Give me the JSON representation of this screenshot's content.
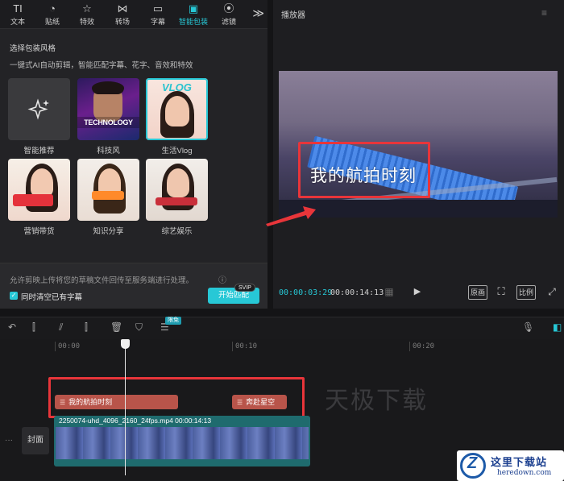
{
  "tabs": [
    {
      "label": "文本",
      "icon": "text-icon",
      "glyph": "TI"
    },
    {
      "label": "贴纸",
      "icon": "sticker-icon",
      "glyph": "◔"
    },
    {
      "label": "特效",
      "icon": "effects-icon",
      "glyph": "☆"
    },
    {
      "label": "转场",
      "icon": "transition-icon",
      "glyph": "⋈"
    },
    {
      "label": "字幕",
      "icon": "caption-icon",
      "glyph": "▭"
    },
    {
      "label": "智能包装",
      "icon": "smart-pack-icon",
      "glyph": "▣"
    },
    {
      "label": "滤镜",
      "icon": "filter-icon",
      "glyph": "⦿"
    }
  ],
  "active_tab": "智能包装",
  "more_tabs_glyph": "≫",
  "panel": {
    "title": "选择包装风格",
    "description": "一键式AI自动剪辑，智能匹配字幕、花字、音效和特效",
    "styles": [
      {
        "label": "智能推荐",
        "thumb_text": ""
      },
      {
        "label": "科技风",
        "thumb_text": "TECHNOLOGY"
      },
      {
        "label": "生活Vlog",
        "thumb_text": "VLOG"
      },
      {
        "label": "营销带货",
        "thumb_text": ""
      },
      {
        "label": "知识分享",
        "thumb_text": ""
      },
      {
        "label": "综艺娱乐",
        "thumb_text": ""
      }
    ],
    "notice": "允许剪映上传将您的草稿文件回传至服务端进行处理。",
    "info_glyph": "ⓘ",
    "checkbox_label": "同时清空已有字幕",
    "checkbox_checked": true,
    "start_button": "开始匹配",
    "svip_badge": "SVIP"
  },
  "player": {
    "title": "播放器",
    "menu_glyph": "≡",
    "subtitle": "我的航拍时刻",
    "time_current": "00:00:03:29",
    "time_total": "00:00:14:13",
    "controls": {
      "grid": "▦",
      "play": "▶",
      "original": "原画",
      "fullscreen_crop": "⛶",
      "ratio": "比例",
      "expand": "⤢"
    }
  },
  "timeline": {
    "free_badge": "限免",
    "ruler": [
      "00:00",
      "00:10",
      "00:20"
    ],
    "tools": {
      "undo": "↶",
      "split_a": "⫿",
      "split_b": "⫽",
      "split_c": "⫿",
      "delete": "🗑",
      "mark": "⛉",
      "caption": "☰",
      "mic": "🎙"
    },
    "text_clips": [
      {
        "label": "我的航拍时刻"
      },
      {
        "label": "奔赴星空"
      }
    ],
    "cover_label": "封面",
    "track_dots": "···",
    "video_clip_label": "2250074-uhd_4096_2160_24fps.mp4   00:00:14:13",
    "clip_icon": "☰"
  },
  "watermark": "天极下载",
  "site_badge": {
    "name": "这里下载站",
    "url": "heredown.com",
    "logo_letter": "Z"
  },
  "colors": {
    "accent": "#27c8d6",
    "highlight": "#e8353a",
    "text_clip": "#b8544a",
    "video_clip": "#1f6b6e"
  }
}
